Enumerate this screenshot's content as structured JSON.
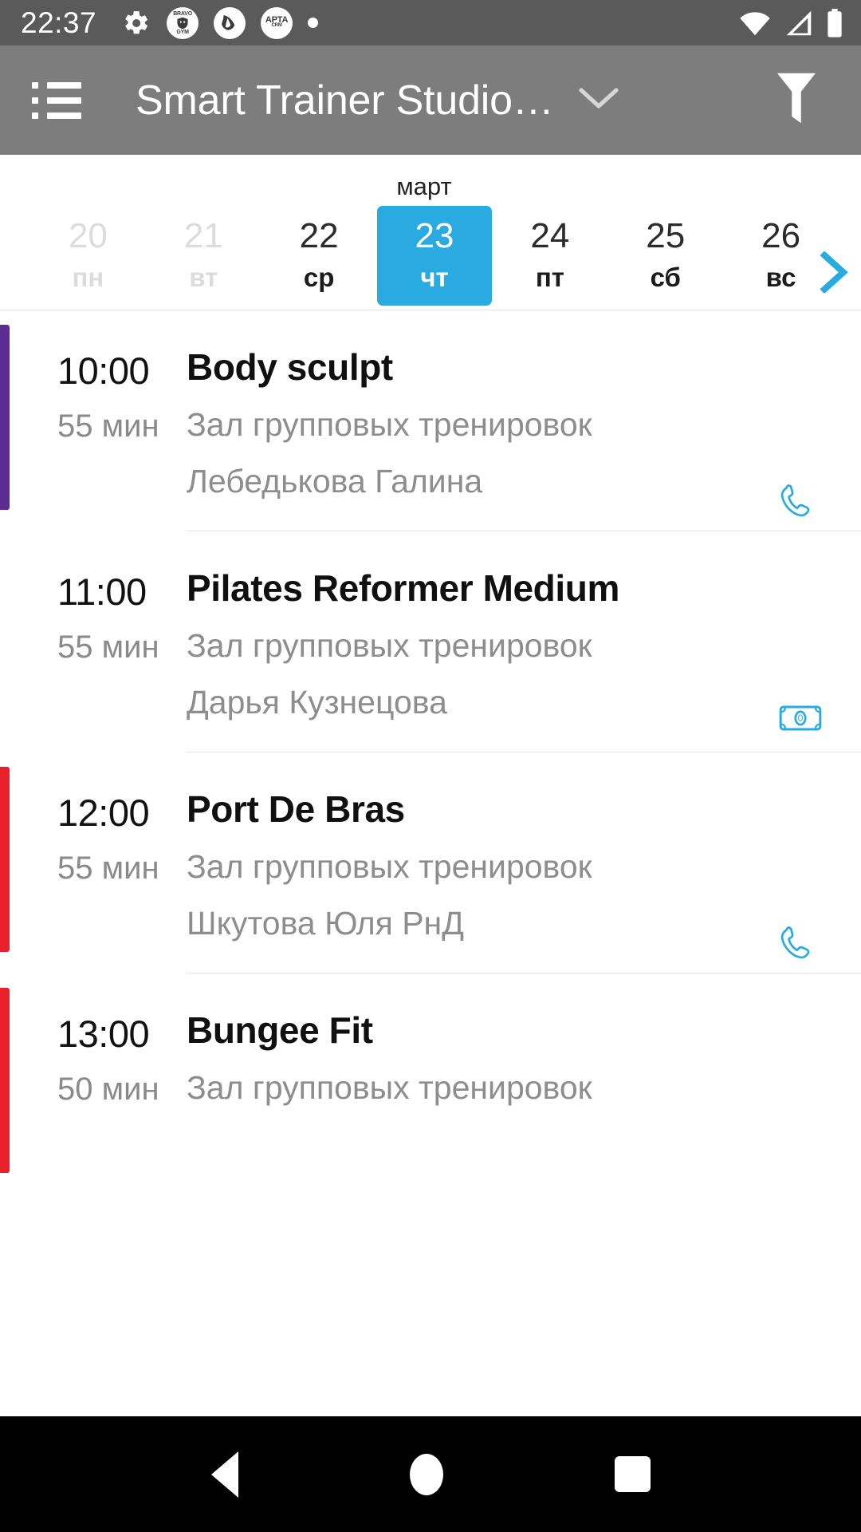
{
  "status_bar": {
    "time": "22:37",
    "left_icons": [
      {
        "name": "gear-icon",
        "glyph": "⚙"
      },
      {
        "name": "bravo-gym-notification-icon",
        "line1": "BRAVO",
        "line2": "GYM"
      },
      {
        "name": "app-notification-icon",
        "glyph": ""
      },
      {
        "name": "arta-notification-icon",
        "line1": "APTA",
        "line2": "CRM"
      },
      {
        "name": "more-notifications-dot",
        "glyph": ""
      }
    ],
    "right_icons": [
      {
        "name": "wifi-icon"
      },
      {
        "name": "cellular-signal-icon"
      },
      {
        "name": "battery-icon"
      }
    ]
  },
  "app_bar": {
    "menu_icon": "list-icon",
    "title": "Smart Trainer Studio…",
    "dropdown_icon": "chevron-down-icon",
    "filter_icon": "filter-icon"
  },
  "date_strip": {
    "month": "март",
    "next_icon": "chevron-right-icon",
    "days": [
      {
        "num": "20",
        "weekday": "пн",
        "state": "past"
      },
      {
        "num": "21",
        "weekday": "вт",
        "state": "past"
      },
      {
        "num": "22",
        "weekday": "ср",
        "state": "normal"
      },
      {
        "num": "23",
        "weekday": "чт",
        "state": "selected"
      },
      {
        "num": "24",
        "weekday": "пт",
        "state": "normal"
      },
      {
        "num": "25",
        "weekday": "сб",
        "state": "normal"
      },
      {
        "num": "26",
        "weekday": "вс",
        "state": "normal"
      }
    ]
  },
  "colors": {
    "accent_blue": "#29abe2",
    "accent_purple": "#5b2d91",
    "accent_red": "#e8202a",
    "status_bar_bg": "#5a5a5a",
    "app_bar_bg": "#7d7d7d",
    "nav_bar_bg": "#000000"
  },
  "schedule": [
    {
      "time": "10:00",
      "duration": "55 мин",
      "title": "Body sculpt",
      "room": "Зал групповых тренировок",
      "trainer": "Лебедькова Галина",
      "accent_color": "#5b2d91",
      "badge_icon": "phone-icon",
      "badge_value": ""
    },
    {
      "time": "11:00",
      "duration": "55 мин",
      "title": "Pilates Reformer Medium",
      "room": "Зал групповых тренировок",
      "trainer": "Дарья Кузнецова",
      "accent_color": "",
      "badge_icon": "banknote-icon",
      "badge_value": "0"
    },
    {
      "time": "12:00",
      "duration": "55 мин",
      "title": "Port De Bras",
      "room": "Зал групповых тренировок",
      "trainer": "Шкутова Юля РнД",
      "accent_color": "#e8202a",
      "badge_icon": "phone-icon",
      "badge_value": ""
    },
    {
      "time": "13:00",
      "duration": "50 мин",
      "title": "Bungee Fit",
      "room": "Зал групповых тренировок",
      "trainer": "",
      "accent_color": "#e8202a",
      "badge_icon": "",
      "badge_value": ""
    }
  ],
  "nav_bar": {
    "back": "back-icon",
    "home": "home-icon",
    "recents": "recents-icon"
  }
}
